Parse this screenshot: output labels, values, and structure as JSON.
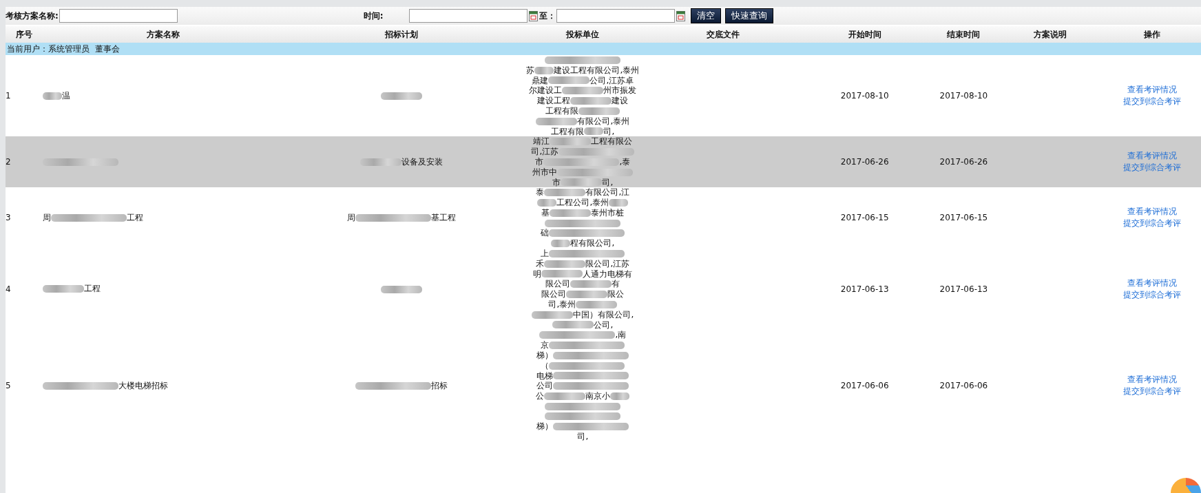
{
  "filter_bar": {
    "name_label": "考核方案名称:",
    "time_label": "时间:",
    "to_label": "至：",
    "buttons": [
      "清空",
      "快速查询"
    ]
  },
  "table": {
    "columns": [
      "序号",
      "方案名称",
      "招标计划",
      "投标单位",
      "交底文件",
      "开始时间",
      "结束时间",
      "方案说明",
      "操作"
    ],
    "user_row": {
      "label": "当前用户：系统管理员",
      "role": "董事会"
    },
    "rows": [
      {
        "selected": false,
        "no": "1",
        "name": [
          {
            "kind": "dab"
          },
          {
            "kind": "text",
            "text": "温"
          }
        ],
        "plan": [
          {
            "kind": "blur"
          }
        ],
        "bidders": [
          [
            {
              "kind": "smear"
            }
          ],
          [
            {
              "kind": "text",
              "text": "苏"
            },
            {
              "kind": "dab"
            },
            {
              "kind": "text",
              "text": "建设工程有限公司,泰州"
            }
          ],
          [
            {
              "kind": "text",
              "text": "鼎建"
            },
            {
              "kind": "blur"
            },
            {
              "kind": "text",
              "text": "公司,江苏卓"
            }
          ],
          [
            {
              "kind": "text",
              "text": "尔建设工"
            },
            {
              "kind": "blur"
            },
            {
              "kind": "text",
              "text": "州市振发"
            }
          ],
          [
            {
              "kind": "text",
              "text": "建设工程"
            },
            {
              "kind": "blur"
            },
            {
              "kind": "text",
              "text": "建设"
            }
          ],
          [
            {
              "kind": "text",
              "text": "工程有限"
            },
            {
              "kind": "blur"
            }
          ],
          [
            {
              "kind": "blur"
            },
            {
              "kind": "text",
              "text": "有限公司,泰州"
            }
          ],
          [
            {
              "kind": "text",
              "text": "工程有限"
            },
            {
              "kind": "dab"
            },
            {
              "kind": "text",
              "text": "司,"
            }
          ]
        ],
        "start": "2017-08-10",
        "end": "2017-08-10",
        "actions": [
          "查看考评情况",
          "提交到综合考评"
        ]
      },
      {
        "selected": true,
        "no": "2",
        "name": [
          {
            "kind": "smear"
          }
        ],
        "plan": [
          {
            "kind": "blur"
          },
          {
            "kind": "text",
            "text": "设备及安装"
          }
        ],
        "bidders": [
          [
            {
              "kind": "text",
              "text": "靖江"
            },
            {
              "kind": "blur"
            },
            {
              "kind": "text",
              "text": "工程有限公"
            }
          ],
          [
            {
              "kind": "text",
              "text": "司,江苏"
            },
            {
              "kind": "smear"
            }
          ],
          [
            {
              "kind": "text",
              "text": "市"
            },
            {
              "kind": "smear"
            },
            {
              "kind": "text",
              "text": ",泰"
            }
          ],
          [
            {
              "kind": "text",
              "text": "州市中"
            },
            {
              "kind": "smear"
            }
          ],
          [
            {
              "kind": "text",
              "text": "市"
            },
            {
              "kind": "blur"
            },
            {
              "kind": "text",
              "text": "司,"
            }
          ]
        ],
        "start": "2017-06-26",
        "end": "2017-06-26",
        "actions": [
          "查看考评情况",
          "提交到综合考评"
        ]
      },
      {
        "selected": false,
        "no": "3",
        "name": [
          {
            "kind": "text",
            "text": "周"
          },
          {
            "kind": "smear"
          },
          {
            "kind": "text",
            "text": "工程"
          }
        ],
        "plan": [
          {
            "kind": "text",
            "text": "周"
          },
          {
            "kind": "smear"
          },
          {
            "kind": "text",
            "text": "基工程"
          }
        ],
        "bidders": [
          [
            {
              "kind": "text",
              "text": "泰"
            },
            {
              "kind": "blur"
            },
            {
              "kind": "text",
              "text": "有限公司,江"
            }
          ],
          [
            {
              "kind": "dab"
            },
            {
              "kind": "text",
              "text": "工程公司,泰州"
            },
            {
              "kind": "dab"
            }
          ],
          [
            {
              "kind": "text",
              "text": "基"
            },
            {
              "kind": "blur"
            },
            {
              "kind": "text",
              "text": "泰州市桩"
            }
          ],
          [
            {
              "kind": "smear"
            }
          ],
          [
            {
              "kind": "text",
              "text": "础"
            },
            {
              "kind": "smear"
            }
          ],
          [
            {
              "kind": "dab"
            },
            {
              "kind": "text",
              "text": "程有限公司,"
            }
          ]
        ],
        "start": "2017-06-15",
        "end": "2017-06-15",
        "actions": [
          "查看考评情况",
          "提交到综合考评"
        ]
      },
      {
        "selected": false,
        "no": "4",
        "name": [
          {
            "kind": "blur"
          },
          {
            "kind": "text",
            "text": "工程"
          }
        ],
        "plan": [
          {
            "kind": "blur"
          }
        ],
        "bidders": [
          [
            {
              "kind": "text",
              "text": "上"
            },
            {
              "kind": "smear"
            }
          ],
          [
            {
              "kind": "text",
              "text": "禾"
            },
            {
              "kind": "blur"
            },
            {
              "kind": "text",
              "text": "限公司,江苏"
            }
          ],
          [
            {
              "kind": "text",
              "text": "明"
            },
            {
              "kind": "blur"
            },
            {
              "kind": "text",
              "text": "人通力电梯有"
            }
          ],
          [
            {
              "kind": "text",
              "text": "限公司"
            },
            {
              "kind": "blur"
            },
            {
              "kind": "text",
              "text": "有"
            }
          ],
          [
            {
              "kind": "text",
              "text": "限公司"
            },
            {
              "kind": "blur"
            },
            {
              "kind": "text",
              "text": "限公"
            }
          ],
          [
            {
              "kind": "text",
              "text": "司,泰州"
            },
            {
              "kind": "blur"
            }
          ],
          [
            {
              "kind": "blur"
            },
            {
              "kind": "text",
              "text": "中国）有限公司,"
            }
          ],
          [
            {
              "kind": "blur"
            },
            {
              "kind": "text",
              "text": "公司,"
            }
          ]
        ],
        "start": "2017-06-13",
        "end": "2017-06-13",
        "actions": [
          "查看考评情况",
          "提交到综合考评"
        ]
      },
      {
        "selected": false,
        "no": "5",
        "name": [
          {
            "kind": "smear"
          },
          {
            "kind": "text",
            "text": "大楼电梯招标"
          }
        ],
        "plan": [
          {
            "kind": "smear"
          },
          {
            "kind": "text",
            "text": "招标"
          }
        ],
        "bidders": [
          [
            {
              "kind": "smear"
            },
            {
              "kind": "text",
              "text": ",南"
            }
          ],
          [
            {
              "kind": "text",
              "text": "京"
            },
            {
              "kind": "smear"
            }
          ],
          [
            {
              "kind": "text",
              "text": "梯）"
            },
            {
              "kind": "smear"
            }
          ],
          [
            {
              "kind": "text",
              "text": "（"
            },
            {
              "kind": "smear"
            }
          ],
          [
            {
              "kind": "text",
              "text": "电梯"
            },
            {
              "kind": "smear"
            }
          ],
          [
            {
              "kind": "text",
              "text": "公司"
            },
            {
              "kind": "smear"
            }
          ],
          [
            {
              "kind": "text",
              "text": "公"
            },
            {
              "kind": "blur"
            },
            {
              "kind": "text",
              "text": "南京小"
            },
            {
              "kind": "dab"
            }
          ],
          [
            {
              "kind": "smear"
            }
          ],
          [
            {
              "kind": "smear"
            }
          ],
          [
            {
              "kind": "text",
              "text": "梯）"
            },
            {
              "kind": "smear"
            }
          ],
          [
            {
              "kind": "text",
              "text": "司,"
            }
          ]
        ],
        "start": "2017-06-06",
        "end": "2017-06-06",
        "actions": [
          "查看考评情况",
          "提交到综合考评"
        ]
      }
    ]
  }
}
